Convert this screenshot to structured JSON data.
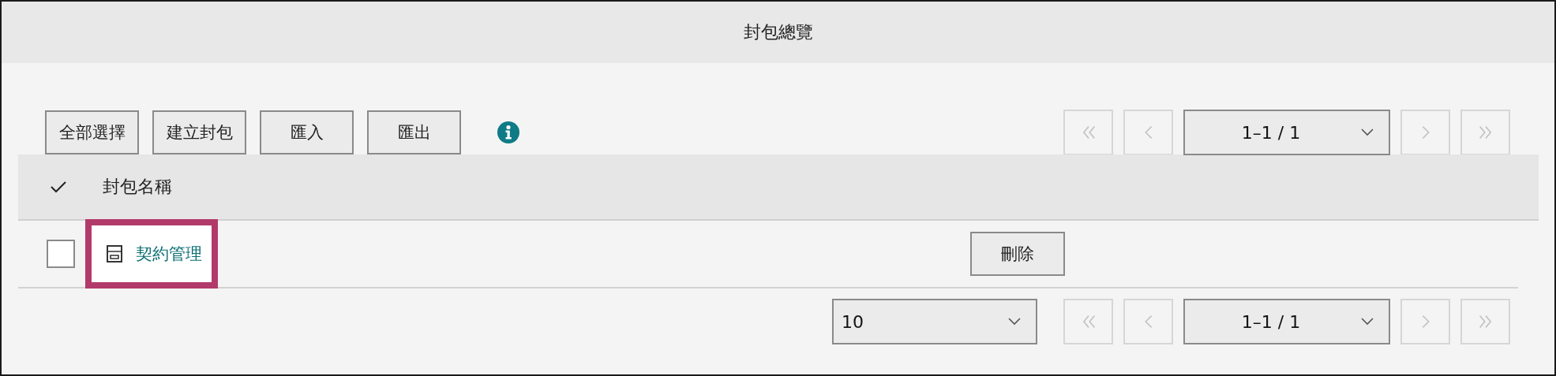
{
  "window": {
    "title": "封包總覽"
  },
  "toolbar": {
    "buttons": [
      "全部選擇",
      "建立封包",
      "匯入",
      "匯出"
    ]
  },
  "pager_top": {
    "page_range": "1–1 / 1",
    "nav": [
      {
        "kind": "first",
        "disabled": true
      },
      {
        "kind": "prev",
        "disabled": true
      },
      {
        "kind": "next",
        "disabled": true
      },
      {
        "kind": "last",
        "disabled": true
      }
    ]
  },
  "table": {
    "columns": [
      "封包名稱"
    ],
    "rows": [
      {
        "name": "契約管理",
        "checked": false,
        "highlighted": true,
        "action": "刪除"
      }
    ]
  },
  "footer": {
    "page_size": "10",
    "pager": {
      "page_range": "1–1 / 1",
      "nav": [
        {
          "kind": "first",
          "disabled": true
        },
        {
          "kind": "prev",
          "disabled": true
        },
        {
          "kind": "next",
          "disabled": true
        },
        {
          "kind": "last",
          "disabled": true
        }
      ]
    }
  }
}
